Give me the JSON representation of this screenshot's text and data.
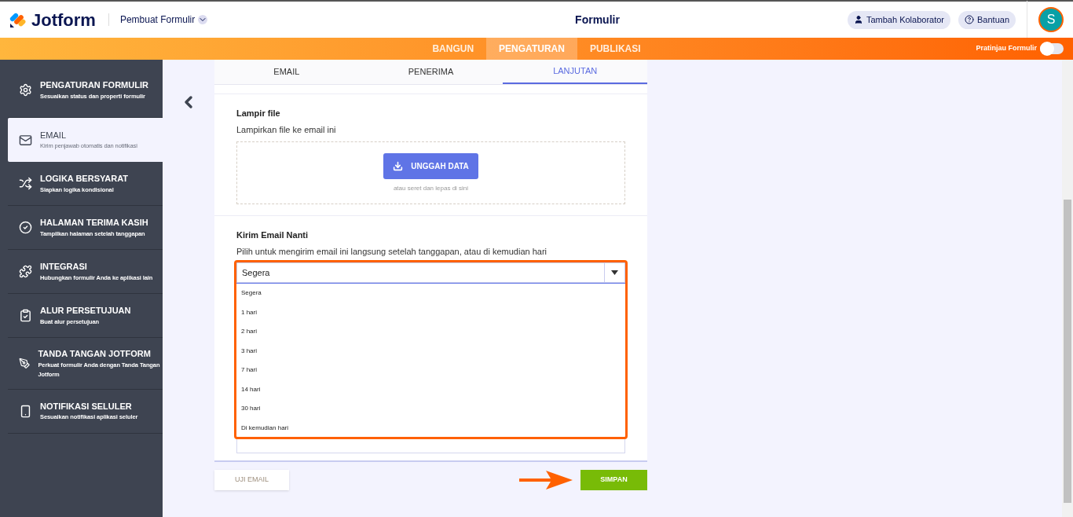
{
  "header": {
    "logo": "Jotform",
    "builder_menu": "Pembuat Formulir",
    "title": "Formulir",
    "collaborator_button": "Tambah Kolaborator",
    "help_button": "Bantuan",
    "avatar": "S"
  },
  "nav_tabs": [
    {
      "label": "BANGUN",
      "selected": false
    },
    {
      "label": "PENGATURAN",
      "selected": true
    },
    {
      "label": "PUBLIKASI",
      "selected": false
    }
  ],
  "preview_toggle": {
    "label": "Pratinjau Formulir",
    "on": false
  },
  "sidebar": {
    "items": [
      {
        "kind": "gear",
        "title": "PENGATURAN FORMULIR",
        "subtitle": "Sesuaikan status dan properti formulir",
        "selected": false
      },
      {
        "kind": "mail",
        "title": "EMAIL",
        "subtitle": "Kirim penjawab otomatis dan notifikasi",
        "selected": true
      },
      {
        "kind": "shuffle",
        "title": "LOGIKA BERSYARAT",
        "subtitle": "Siapkan logika kondisional",
        "selected": false
      },
      {
        "kind": "check",
        "title": "HALAMAN TERIMA KASIH",
        "subtitle": "Tampilkan halaman setelah tanggapan",
        "selected": false
      },
      {
        "kind": "puzzle",
        "title": "INTEGRASI",
        "subtitle": "Hubungkan formulir Anda ke aplikasi lain",
        "selected": false
      },
      {
        "kind": "approval",
        "title": "ALUR PERSETUJUAN",
        "subtitle": "Buat alur persetujuan",
        "selected": false
      },
      {
        "kind": "pen",
        "title": "TANDA TANGAN JOTFORM",
        "subtitle": "Perkuat formulir Anda dengan Tanda Tangan Jotform",
        "selected": false
      },
      {
        "kind": "phone",
        "title": "NOTIFIKASI SELULER",
        "subtitle": "Sesuaikan notifikasi aplikasi seluler",
        "selected": false
      }
    ]
  },
  "email_tabs": [
    {
      "label": "EMAIL",
      "selected": false
    },
    {
      "label": "PENERIMA",
      "selected": false
    },
    {
      "label": "LANJUTAN",
      "selected": true
    }
  ],
  "attach_file": {
    "title": "Lampir file",
    "description": "Lampirkan file ke email ini",
    "upload_button": "UNGGAH DATA",
    "drop_hint": "atau seret dan lepas di sini"
  },
  "send_later": {
    "title": "Kirim Email Nanti",
    "description": "Pilih untuk mengirim email ini langsung setelah tanggapan, atau di kemudian hari",
    "value": "Segera",
    "options": [
      "Segera",
      "1 hari",
      "2 hari",
      "3 hari",
      "7 hari",
      "14 hari",
      "30 hari",
      "Di kemudian hari"
    ]
  },
  "footer": {
    "test_button": "UJI EMAIL",
    "save_button": "SIMPAN"
  }
}
